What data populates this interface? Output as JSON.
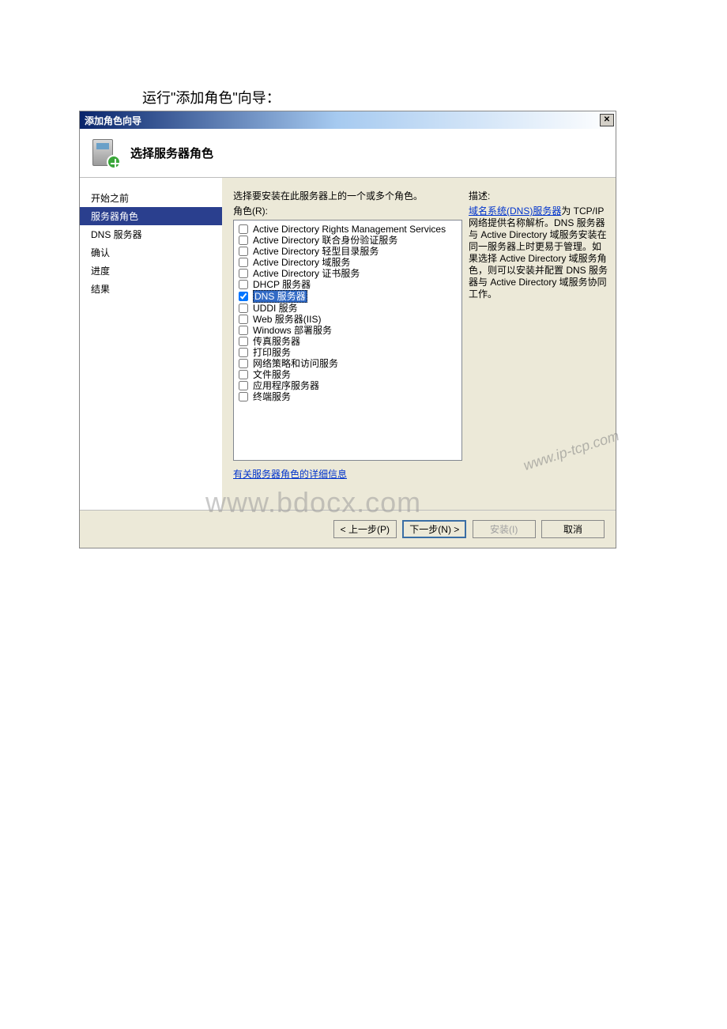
{
  "intro": "运行\"添加角色\"向导：",
  "window_title": "添加角色向导",
  "banner_title": "选择服务器角色",
  "sidebar": {
    "items": [
      {
        "label": "开始之前",
        "active": false
      },
      {
        "label": "服务器角色",
        "active": true
      },
      {
        "label": "DNS 服务器",
        "active": false
      },
      {
        "label": "确认",
        "active": false
      },
      {
        "label": "进度",
        "active": false
      },
      {
        "label": "结果",
        "active": false
      }
    ]
  },
  "instruction": "选择要安装在此服务器上的一个或多个角色。",
  "role_label": "角色(R):",
  "roles": [
    {
      "name": "Active Directory Rights Management Services",
      "checked": false,
      "selected": false
    },
    {
      "name": "Active Directory 联合身份验证服务",
      "checked": false,
      "selected": false
    },
    {
      "name": "Active Directory 轻型目录服务",
      "checked": false,
      "selected": false
    },
    {
      "name": "Active Directory 域服务",
      "checked": false,
      "selected": false
    },
    {
      "name": "Active Directory 证书服务",
      "checked": false,
      "selected": false
    },
    {
      "name": "DHCP 服务器",
      "checked": false,
      "selected": false
    },
    {
      "name": "DNS 服务器",
      "checked": true,
      "selected": true
    },
    {
      "name": "UDDI 服务",
      "checked": false,
      "selected": false
    },
    {
      "name": "Web 服务器(IIS)",
      "checked": false,
      "selected": false
    },
    {
      "name": "Windows 部署服务",
      "checked": false,
      "selected": false
    },
    {
      "name": "传真服务器",
      "checked": false,
      "selected": false
    },
    {
      "name": "打印服务",
      "checked": false,
      "selected": false
    },
    {
      "name": "网络策略和访问服务",
      "checked": false,
      "selected": false
    },
    {
      "name": "文件服务",
      "checked": false,
      "selected": false
    },
    {
      "name": "应用程序服务器",
      "checked": false,
      "selected": false
    },
    {
      "name": "终端服务",
      "checked": false,
      "selected": false
    }
  ],
  "more_info_link": "有关服务器角色的详细信息",
  "desc": {
    "title": "描述:",
    "link_text": "域名系统(DNS)服务器",
    "body": "为 TCP/IP 网络提供名称解析。DNS 服务器与 Active Directory 域服务安装在同一服务器上时更易于管理。如果选择 Active Directory 域服务角色，则可以安装并配置 DNS 服务器与 Active Directory 域服务协同工作。"
  },
  "buttons": {
    "prev": "< 上一步(P)",
    "next": "下一步(N) >",
    "install": "安装(I)",
    "cancel": "取消"
  },
  "watermarks": {
    "w1": "www.bdocx.com",
    "w2": "www.ip-tcp.com"
  }
}
